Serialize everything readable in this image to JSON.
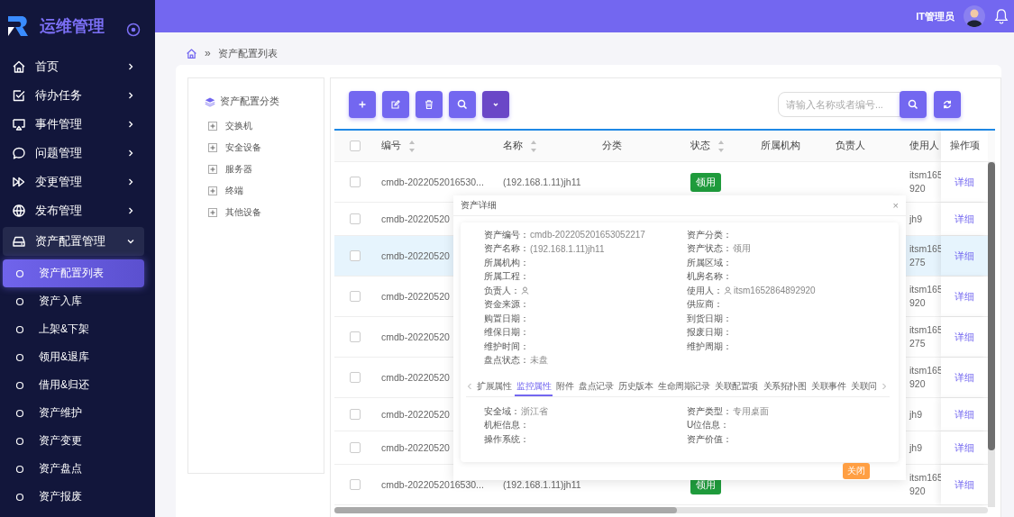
{
  "sidebar": {
    "title": "运维管理",
    "items": [
      {
        "label": "首页",
        "expanded": false
      },
      {
        "label": "待办任务",
        "expanded": false
      },
      {
        "label": "事件管理",
        "expanded": false
      },
      {
        "label": "问题管理",
        "expanded": false
      },
      {
        "label": "变更管理",
        "expanded": false
      },
      {
        "label": "发布管理",
        "expanded": false
      },
      {
        "label": "资产配置管理",
        "expanded": true,
        "children": [
          {
            "label": "资产配置列表",
            "selected": true
          },
          {
            "label": "资产入库",
            "selected": false
          },
          {
            "label": "上架&下架",
            "selected": false
          },
          {
            "label": "领用&退库",
            "selected": false
          },
          {
            "label": "借用&归还",
            "selected": false
          },
          {
            "label": "资产维护",
            "selected": false
          },
          {
            "label": "资产变更",
            "selected": false
          },
          {
            "label": "资产盘点",
            "selected": false
          },
          {
            "label": "资产报废",
            "selected": false
          }
        ]
      }
    ]
  },
  "header": {
    "user": "IT管理员"
  },
  "breadcrumb": {
    "separator": "»",
    "items": [
      "资产配置列表"
    ]
  },
  "category_panel": {
    "title": "资产配置分类",
    "nodes": [
      {
        "label": "交换机",
        "expanded": false
      },
      {
        "label": "安全设备",
        "expanded": false
      },
      {
        "label": "服务器",
        "expanded": false
      },
      {
        "label": "终端",
        "expanded": false
      },
      {
        "label": "其他设备",
        "expanded": false
      }
    ]
  },
  "toolbar": {
    "search": {
      "placeholder": "请输入名称或者编号..."
    }
  },
  "table": {
    "all_checked": false,
    "columns": [
      {
        "label": "编号",
        "sortable": true
      },
      {
        "label": "名称",
        "sortable": true
      },
      {
        "label": "分类",
        "sortable": false
      },
      {
        "label": "状态",
        "sortable": true
      },
      {
        "label": "所属机构",
        "sortable": false
      },
      {
        "label": "负责人",
        "sortable": false
      },
      {
        "label": "使用人",
        "sortable": false
      },
      {
        "label": "操作项",
        "sortable": false
      }
    ],
    "rows": [
      {
        "checked": false,
        "selected": false,
        "code": "cmdb-2022052016530...",
        "name": "(192.168.1.11)jh11",
        "status": "领用",
        "user": "itsm165\n920",
        "action": "详细"
      },
      {
        "checked": false,
        "selected": false,
        "code": "cmdb-20220520",
        "user": "jh9",
        "action": "详细"
      },
      {
        "checked": false,
        "selected": true,
        "code": "cmdb-20220520",
        "user": "itsm165\n275",
        "action": "详细"
      },
      {
        "checked": false,
        "selected": false,
        "code": "cmdb-20220520",
        "user": "itsm165\n920",
        "action": "详细"
      },
      {
        "checked": false,
        "selected": false,
        "code": "cmdb-20220520",
        "user": "itsm165\n275",
        "action": "详细"
      },
      {
        "checked": false,
        "selected": false,
        "code": "cmdb-20220520",
        "user": "itsm165\n920",
        "action": "详细"
      },
      {
        "checked": false,
        "selected": false,
        "code": "cmdb-20220520",
        "user": "jh9",
        "action": "详细"
      },
      {
        "checked": false,
        "selected": false,
        "code": "cmdb-20220520",
        "user": "jh9",
        "action": "详细"
      },
      {
        "checked": false,
        "selected": false,
        "code": "cmdb-2022052016530...",
        "name": "(192.168.1.11)jh11",
        "status": "领用",
        "user": "itsm165\n920",
        "action": "详细"
      }
    ]
  },
  "dialog": {
    "title": "资产详细",
    "close": "×",
    "fields": [
      {
        "kind": "text",
        "label": "资产编号：",
        "value": "cmdb-202205201653052217"
      },
      {
        "kind": "text",
        "label": "资产分类："
      },
      {
        "kind": "text",
        "label": "资产名称：",
        "value": "(192.168.1.11)jh11"
      },
      {
        "kind": "text",
        "label": "资产状态：",
        "value": "领用"
      },
      {
        "kind": "text",
        "label": "所属机构："
      },
      {
        "kind": "text",
        "label": "所属区域："
      },
      {
        "kind": "text",
        "label": "所属工程："
      },
      {
        "kind": "text",
        "label": "机房名称："
      },
      {
        "kind": "person",
        "label": "负责人："
      },
      {
        "kind": "person",
        "label": "使用人：",
        "value": "itsm1652864892920"
      },
      {
        "kind": "text",
        "label": "资金来源："
      },
      {
        "kind": "text",
        "label": "供应商："
      },
      {
        "kind": "text",
        "label": "购置日期："
      },
      {
        "kind": "text",
        "label": "到货日期："
      },
      {
        "kind": "text",
        "label": "维保日期："
      },
      {
        "kind": "text",
        "label": "报废日期："
      },
      {
        "kind": "text",
        "label": "维护时间："
      },
      {
        "kind": "text",
        "label": "维护周期："
      },
      {
        "kind": "text",
        "label": "盘点状态：",
        "value": "未盘"
      }
    ],
    "tabs": [
      {
        "label": "扩展属性",
        "selected": false
      },
      {
        "label": "监控属性",
        "selected": true
      },
      {
        "label": "附件",
        "selected": false
      },
      {
        "label": "盘点记录",
        "selected": false
      },
      {
        "label": "历史版本",
        "selected": false
      },
      {
        "label": "生命周期记录",
        "selected": false
      },
      {
        "label": "关联配置项",
        "selected": false
      },
      {
        "label": "关系拓扑图",
        "selected": false
      },
      {
        "label": "关联事件",
        "selected": false
      },
      {
        "label": "关联问",
        "selected": false
      }
    ],
    "tab_fields": [
      {
        "label": "安全域：",
        "value": "浙江省"
      },
      {
        "label": "资产类型：",
        "value": "专用桌面"
      },
      {
        "label": "机柜信息："
      },
      {
        "label": "U位信息："
      },
      {
        "label": "操作系统："
      },
      {
        "label": "资产价值："
      }
    ],
    "close_button": "关闭"
  }
}
